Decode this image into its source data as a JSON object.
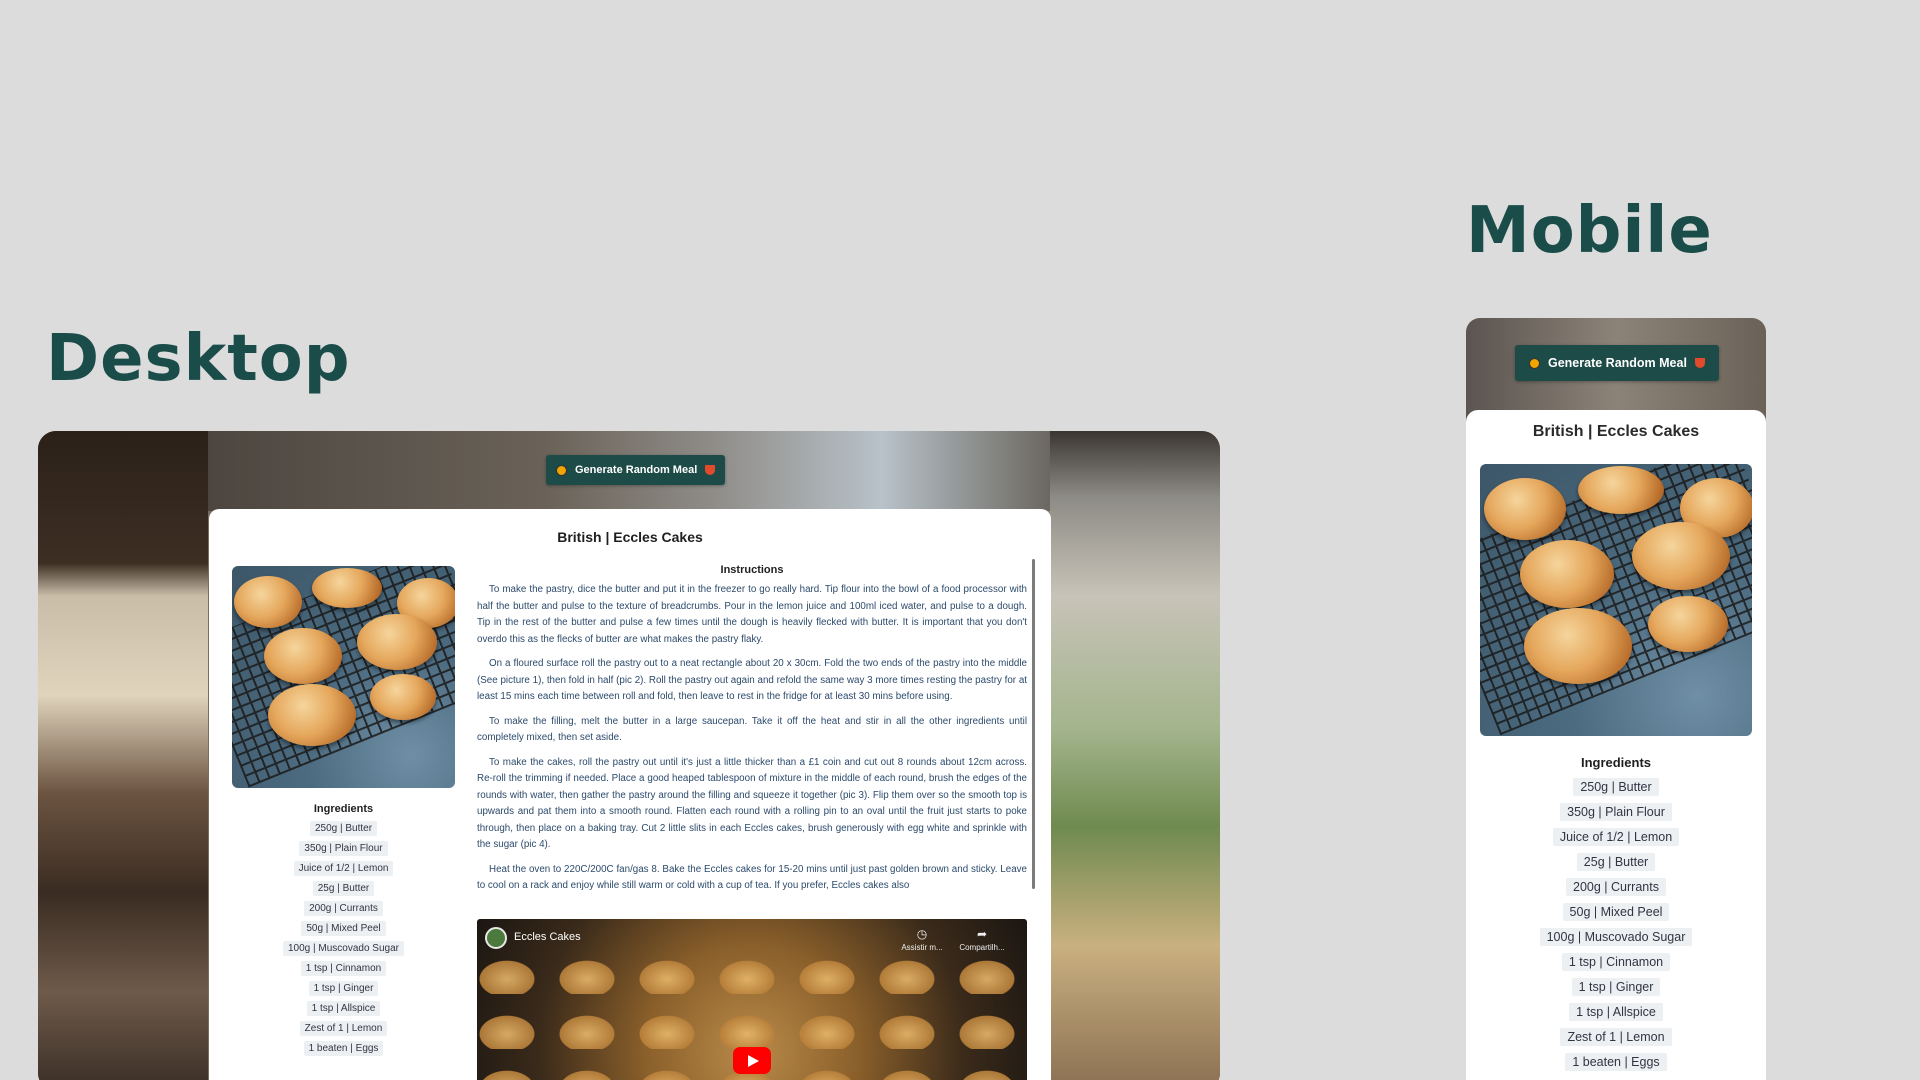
{
  "headings": {
    "desktop": "Desktop",
    "mobile": "Mobile"
  },
  "meal": {
    "generate_button_label": "Generate Random Meal",
    "title": "British | Eccles Cakes",
    "ingredients_heading": "Ingredients",
    "ingredients": [
      "250g | Butter",
      "350g | Plain Flour",
      "Juice of 1/2 | Lemon",
      "25g | Butter",
      "200g | Currants",
      "50g | Mixed Peel",
      "100g | Muscovado Sugar",
      "1 tsp | Cinnamon",
      "1 tsp | Ginger",
      "1 tsp | Allspice",
      "Zest of 1 | Lemon",
      "1 beaten | Eggs"
    ],
    "instructions_heading": "Instructions",
    "instructions": [
      "To make the pastry, dice the butter and put it in the freezer to go really hard. Tip flour into the bowl of a food processor with half the butter and pulse to the texture of breadcrumbs. Pour in the lemon juice and 100ml iced water, and pulse to a dough. Tip in the rest of the butter and pulse a few times until the dough is heavily flecked with butter. It is important that you don't overdo this as the flecks of butter are what makes the pastry flaky.",
      "On a floured surface roll the pastry out to a neat rectangle about 20 x 30cm. Fold the two ends of the pastry into the middle (See picture 1), then fold in half (pic 2). Roll the pastry out again and refold the same way 3 more times resting the pastry for at least 15 mins each time between roll and fold, then leave to rest in the fridge for at least 30 mins before using.",
      "To make the filling, melt the butter in a large saucepan. Take it off the heat and stir in all the other ingredients until completely mixed, then set aside.",
      "To make the cakes, roll the pastry out until it's just a little thicker than a £1 coin and cut out 8 rounds about 12cm across. Re-roll the trimming if needed. Place a good heaped tablespoon of mixture in the middle of each round, brush the edges of the rounds with water, then gather the pastry around the filling and squeeze it together (pic 3). Flip them over so the smooth top is upwards and pat them into a smooth round. Flatten each round with a rolling pin to an oval until the fruit just starts to poke through, then place on a baking tray. Cut 2 little slits in each Eccles cakes, brush generously with egg white and sprinkle with the sugar (pic 4).",
      "Heat the oven to 220C/200C fan/gas 8. Bake the Eccles cakes for 15-20 mins until just past golden brown and sticky. Leave to cool on a rack and enjoy while still warm or cold with a cup of tea. If you prefer, Eccles cakes also"
    ],
    "video": {
      "title": "Eccles Cakes",
      "watch_later_label": "Assistir m...",
      "share_label": "Compartilh..."
    }
  },
  "colors": {
    "accent": "#1d4b47",
    "heading": "#1a4d4a",
    "background": "#dcdcdc",
    "youtube_red": "#ff0000"
  },
  "icons": [
    "meal-dot-icon",
    "bowl-icon",
    "channel-logo-icon",
    "clock-icon",
    "share-icon",
    "youtube-play-icon"
  ]
}
